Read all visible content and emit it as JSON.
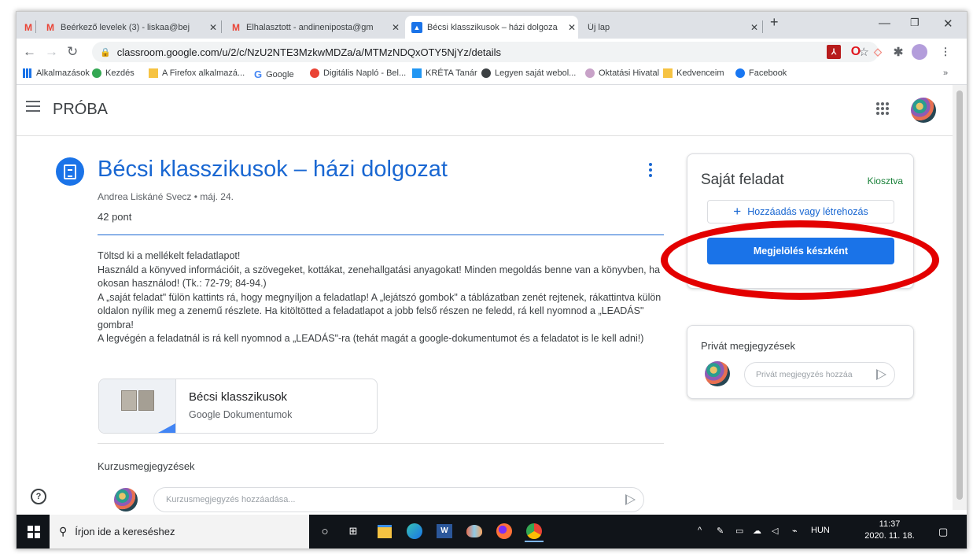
{
  "tabs": [
    {
      "label": "Beérkező levelek (3) - liskaa@bej",
      "icon": "gmail-icon"
    },
    {
      "label": "Elhalasztott - andineniposta@gm",
      "icon": "gmail-icon"
    },
    {
      "label": "Bécsi klasszikusok – házi dolgoza",
      "icon": "classroom-icon"
    },
    {
      "label": "Új lap",
      "icon": "none"
    }
  ],
  "address": {
    "url": "classroom.google.com/u/2/c/NzU2NTE3MzkwMDZa/a/MTMzNDQxOTY5NjYz/details"
  },
  "bookmarks": [
    {
      "label": "Alkalmazások",
      "color": "#1a73e8"
    },
    {
      "label": "Kezdés",
      "color": "#34a853"
    },
    {
      "label": "A Firefox alkalmazá...",
      "color": "#f6c342"
    },
    {
      "label": "Google",
      "color": "#4285f4"
    },
    {
      "label": "Digitális Napló - Bel...",
      "color": "#ea4335"
    },
    {
      "label": "KRÉTA Tanár",
      "color": "#2196f3"
    },
    {
      "label": "Legyen saját webol...",
      "color": "#202124"
    },
    {
      "label": "Oktatási Hivatal",
      "color": "#c8a2c8"
    },
    {
      "label": "Kedvenceim",
      "color": "#f6c342"
    },
    {
      "label": "Facebook",
      "color": "#1877f2"
    }
  ],
  "classroom": {
    "class_name": "PRÓBA"
  },
  "assignment": {
    "title": "Bécsi klasszikusok – házi dolgozat",
    "meta": "Andrea Liskáné Svecz • máj. 24.",
    "points": "42 pont",
    "description": "Töltsd ki a mellékelt feladatlapot!\nHasználd a könyved információit, a szövegeket, kottákat, zenehallgatási anyagokat! Minden megoldás benne van a könyvben, ha okosan használod! (Tk.: 72-79; 84-94.)\nA „saját feladat\" fülön kattints rá, hogy megnyíljon a feladatlap! A „lejátszó gombok\" a táblázatban zenét rejtenek, rákattintva külön oldalon nyílik meg a zenemű részlete. Ha kitöltötted a feladatlapot a jobb felső részen ne feledd, rá kell nyomnod a „LEADÁS\" gombra!\nA legvégén a feladatnál is rá kell nyomnod a „LEADÁS\"-ra (tehát magát a google-dokumentumot és a feladatot is le kell adni!)",
    "attachment": {
      "title": "Bécsi klasszikusok",
      "subtitle": "Google Dokumentumok"
    },
    "comments_heading": "Kurzusmegjegyzések",
    "comment_placeholder": "Kurzusmegjegyzés hozzáadása..."
  },
  "own_work": {
    "title": "Saját feladat",
    "status": "Kiosztva",
    "add_label": "Hozzáadás vagy létrehozás",
    "mark_done_label": "Megjelölés készként"
  },
  "private_comments": {
    "title": "Privát megjegyzések",
    "placeholder": "Privát megjegyzés hozzáa"
  },
  "taskbar": {
    "search_placeholder": "Írjon ide a kereséshez",
    "language": "HUN",
    "time": "11:37",
    "date": "2020. 11. 18."
  },
  "colors": {
    "accent": "#1a73e8",
    "status_green": "#188038",
    "highlight_red": "#e30000"
  }
}
